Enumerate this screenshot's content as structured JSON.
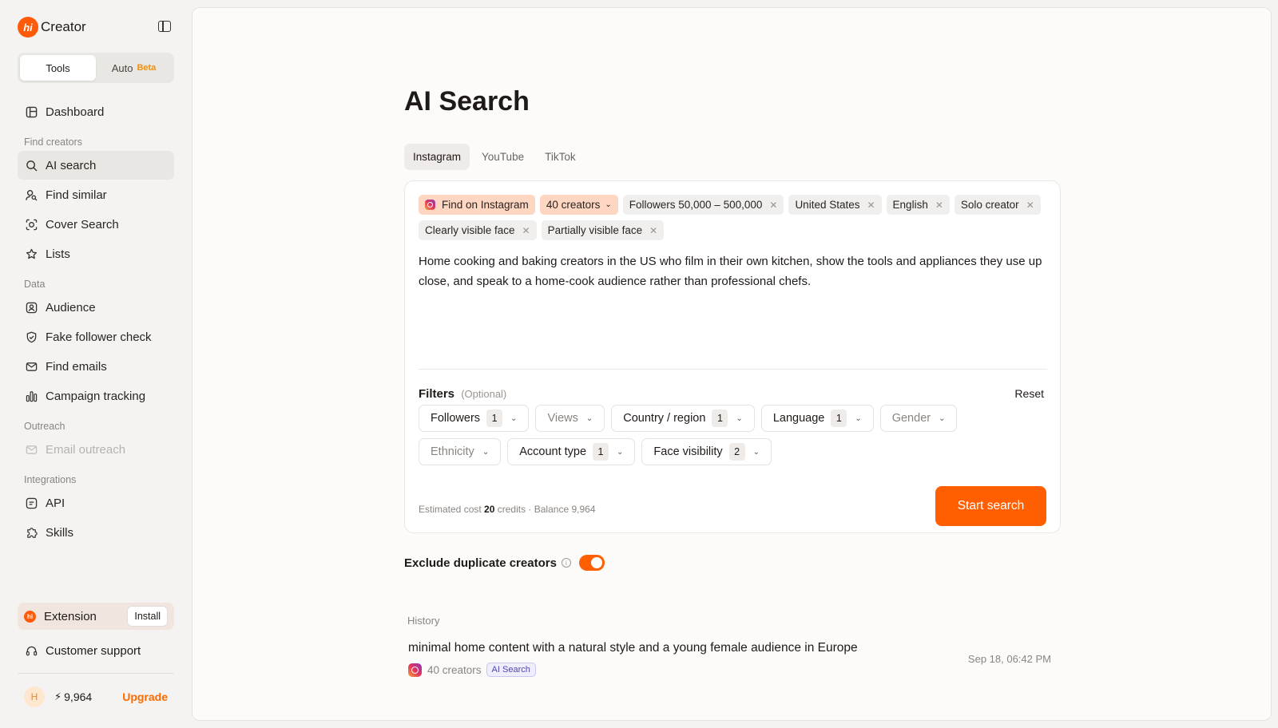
{
  "brand": {
    "logo_text": "hi",
    "name": "Creator"
  },
  "mode_switch": {
    "tools": "Tools",
    "auto": "Auto",
    "beta": "Beta"
  },
  "sidebar": {
    "dashboard": "Dashboard",
    "sections": {
      "find_creators": "Find creators",
      "data": "Data",
      "outreach": "Outreach",
      "integrations": "Integrations"
    },
    "items": {
      "ai_search": "AI search",
      "find_similar": "Find similar",
      "cover_search": "Cover Search",
      "lists": "Lists",
      "audience": "Audience",
      "fake_follower_check": "Fake follower check",
      "find_emails": "Find emails",
      "campaign_tracking": "Campaign tracking",
      "email_outreach": "Email outreach",
      "api": "API",
      "skills": "Skills"
    },
    "extension": {
      "label": "Extension",
      "install": "Install"
    },
    "support": "Customer support",
    "user": {
      "avatar": "H",
      "credits": "9,964",
      "upgrade": "Upgrade"
    }
  },
  "main": {
    "title": "AI Search",
    "tabs": [
      "Instagram",
      "YouTube",
      "TikTok"
    ],
    "chips": {
      "platform": "Find on Instagram",
      "count": "40 creators",
      "followers": "Followers 50,000 – 500,000",
      "country": "United States",
      "language": "English",
      "account": "Solo creator",
      "face1": "Clearly visible face",
      "face2": "Partially visible face"
    },
    "prompt": "Home cooking and baking creators in the US who film in their own kitchen, show the tools and appliances they use up close, and speak to a home-cook audience rather than professional chefs.",
    "filters": {
      "title": "Filters",
      "optional": "(Optional)",
      "reset": "Reset",
      "followers": {
        "label": "Followers",
        "count": "1"
      },
      "views": {
        "label": "Views"
      },
      "country": {
        "label": "Country / region",
        "count": "1"
      },
      "language": {
        "label": "Language",
        "count": "1"
      },
      "gender": {
        "label": "Gender"
      },
      "ethnicity": {
        "label": "Ethnicity"
      },
      "account_type": {
        "label": "Account type",
        "count": "1"
      },
      "face_visibility": {
        "label": "Face visibility",
        "count": "2"
      }
    },
    "cost": {
      "prefix": "Estimated cost",
      "amount": "20",
      "suffix": "credits · Balance 9,964"
    },
    "start_button": "Start search",
    "exclude_label": "Exclude duplicate creators",
    "exclude_enabled": true,
    "history": {
      "label": "History",
      "items": [
        {
          "text": "minimal home content with a natural style and a young female audience in Europe",
          "count": "40 creators",
          "badge": "AI Search",
          "time": "Sep 18, 06:42 PM"
        }
      ]
    }
  },
  "colors": {
    "accent": "#ff5f00",
    "brand": "#ff5a0a",
    "chip_highlight": "#ffd6c2"
  }
}
